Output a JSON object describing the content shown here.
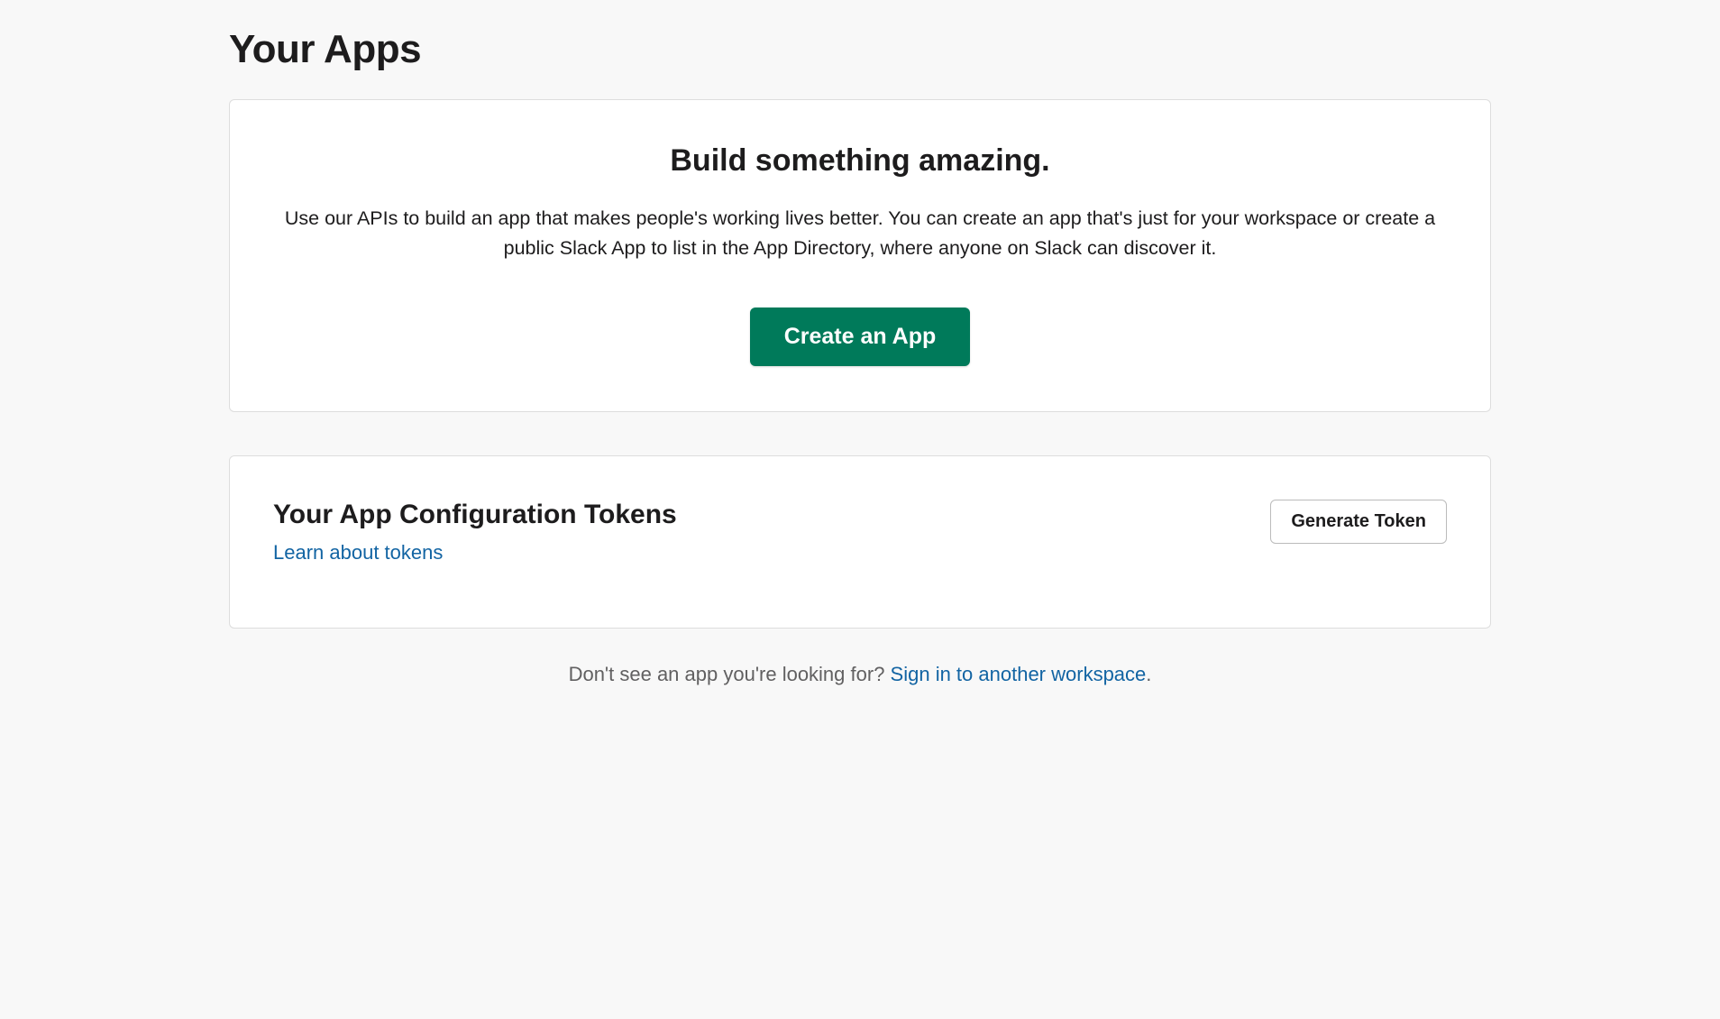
{
  "page": {
    "title": "Your Apps"
  },
  "hero": {
    "title": "Build something amazing.",
    "description": "Use our APIs to build an app that makes people's working lives better. You can create an app that's just for your workspace or create a public Slack App to list in the App Directory, where anyone on Slack can discover it.",
    "button_label": "Create an App"
  },
  "tokens": {
    "title": "Your App Configuration Tokens",
    "learn_link": "Learn about tokens",
    "button_label": "Generate Token"
  },
  "footer": {
    "prompt": "Don't see an app you're looking for? ",
    "link_text": "Sign in to another workspace",
    "suffix": "."
  }
}
